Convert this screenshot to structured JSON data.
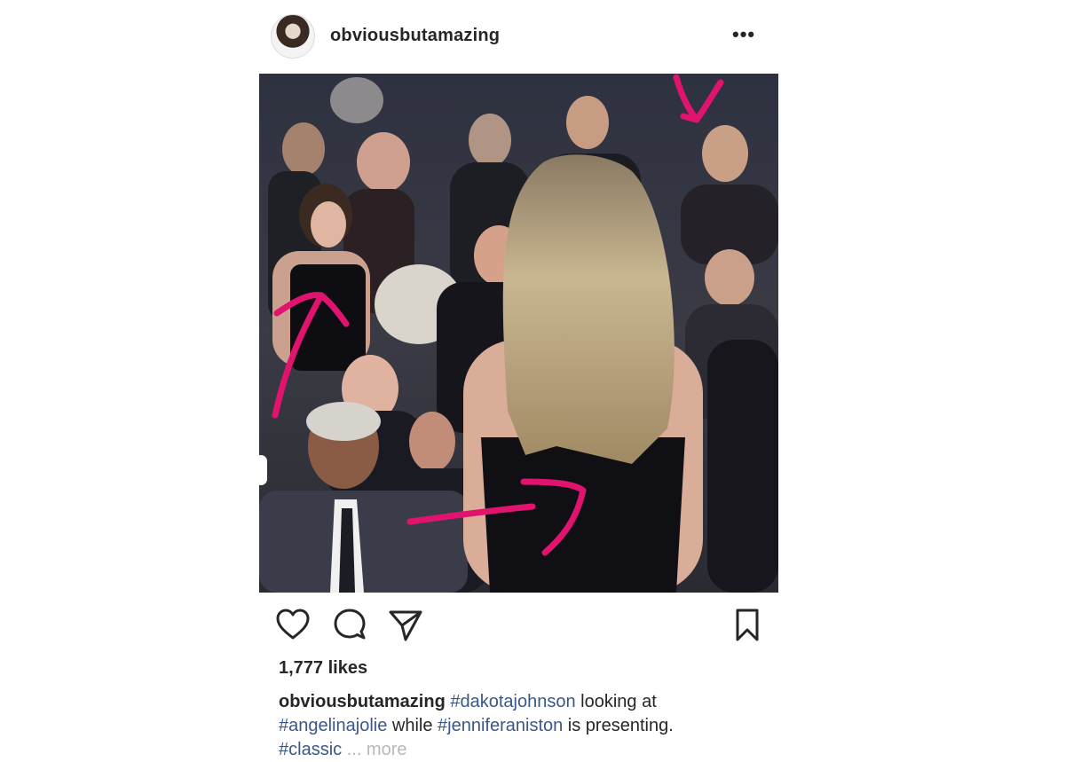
{
  "post": {
    "username": "obviousbutamazing",
    "more_label": "•••",
    "likes": "1,777 likes",
    "caption": {
      "username": "obviousbutamazing",
      "line1_tag": "#dakotajohnson",
      "line1_text": " looking at",
      "line2_tag1": "#angelinajolie",
      "line2_text": " while ",
      "line2_tag2": "#jenniferaniston",
      "line2_text2": " is presenting.",
      "line3_tag": "#classic",
      "more": "... more"
    }
  },
  "actions": {
    "icons": [
      "heart-icon",
      "comment-icon",
      "share-icon",
      "bookmark-icon"
    ]
  },
  "colors": {
    "hashtag": "#3b5788",
    "annotation_arrow": "#e0146e"
  }
}
